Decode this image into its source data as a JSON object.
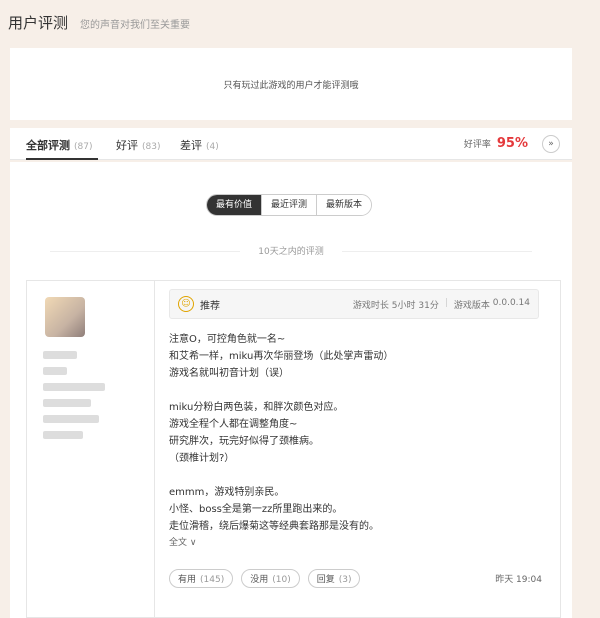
{
  "header": {
    "title": "用户评测",
    "subtitle": "您的声音对我们至关重要"
  },
  "notice": {
    "text": "只有玩过此游戏的用户才能评测哦"
  },
  "tabs": [
    {
      "label": "全部评测",
      "count": "(87)"
    },
    {
      "label": "好评",
      "count": "(83)"
    },
    {
      "label": "差评",
      "count": "(4)"
    }
  ],
  "rating": {
    "label": "好评率",
    "value": "95%",
    "expand_icon": "chevron-double-down-icon"
  },
  "sort": {
    "options": [
      "最有价值",
      "最近评测",
      "最新版本"
    ],
    "active": "最有价值"
  },
  "period": "10天之内的评测",
  "review": {
    "recommend": "推荐",
    "play_time_label": "游戏时长",
    "play_time": "5小时 31分",
    "version_label": "游戏版本",
    "version": "0.0.0.14",
    "lines": [
      "注意O，可控角色就一名~",
      "和艾希一样，miku再次华丽登场（此处掌声雷动）",
      "游戏名就叫初音计划（误）",
      "",
      "miku分粉白两色装，和胖次颜色对应。",
      "游戏全程个人都在调整角度~",
      "研究胖次，玩完好似得了颈椎病。",
      "（颈椎计划?）",
      "",
      "emmm，游戏特别亲民。",
      "小怪、boss全是第一zz所里跑出来的。",
      "走位滑稽，绕后爆菊这等经典套路那是没有的。"
    ],
    "full_text_link": "全文 ∨",
    "helpful_label": "有用",
    "helpful_count": "(145)",
    "unhelpful_label": "没用",
    "unhelpful_count": "(10)",
    "reply_label": "回复",
    "reply_count": "(3)",
    "time": "昨天 19:04"
  },
  "colors": {
    "accent_red": "#e4393c",
    "active_dark": "#333333",
    "page_bg": "#f7efe8"
  }
}
